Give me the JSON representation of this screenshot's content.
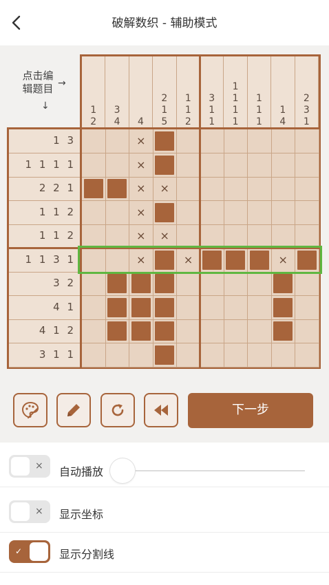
{
  "header": {
    "title": "破解数织 - 辅助模式"
  },
  "corner": {
    "line1": "点击编",
    "line2": "辑题目",
    "arrow_right": "→",
    "arrow_down": "↓"
  },
  "col_clues": [
    [
      "1",
      "2"
    ],
    [
      "3",
      "4"
    ],
    [
      "4"
    ],
    [
      "2",
      "1",
      "5"
    ],
    [
      "1",
      "1",
      "2"
    ],
    [
      "3",
      "1",
      "1"
    ],
    [
      "1",
      "1",
      "1",
      "1"
    ],
    [
      "1",
      "1",
      "1"
    ],
    [
      "1",
      "4"
    ],
    [
      "2",
      "3",
      "1"
    ]
  ],
  "row_clues": [
    "1 3",
    "1 1 1 1",
    "2 2 1",
    "1 1 2",
    "1 1 2",
    "1 1 3 1",
    "3 2",
    "4 1",
    "4 1 2",
    "3 1 1"
  ],
  "grid": [
    ". . x f . . . . . .",
    ". . x f . . . . . .",
    "f f x x . . . . . .",
    ". . x f . . . . . .",
    ". . x x . . . . . .",
    ". . x f x f f f x f",
    ". f f f . . . . f .",
    ". f f f . . . . f .",
    ". f f f . . . . f .",
    ". . . f . . . . . ."
  ],
  "cross_symbol": "×",
  "toolbar": {
    "next_label": "下一步"
  },
  "settings": [
    {
      "label": "自动播放",
      "on": false,
      "mark": "×"
    },
    {
      "label": "显示坐标",
      "on": false,
      "mark": "×"
    },
    {
      "label": "显示分割线",
      "on": true,
      "mark": "✓"
    }
  ],
  "autoplay_slider": {
    "value": 0
  },
  "colors": {
    "accent": "#a7643b",
    "board": "#e8d4c2",
    "highlight": "#5fb741"
  }
}
